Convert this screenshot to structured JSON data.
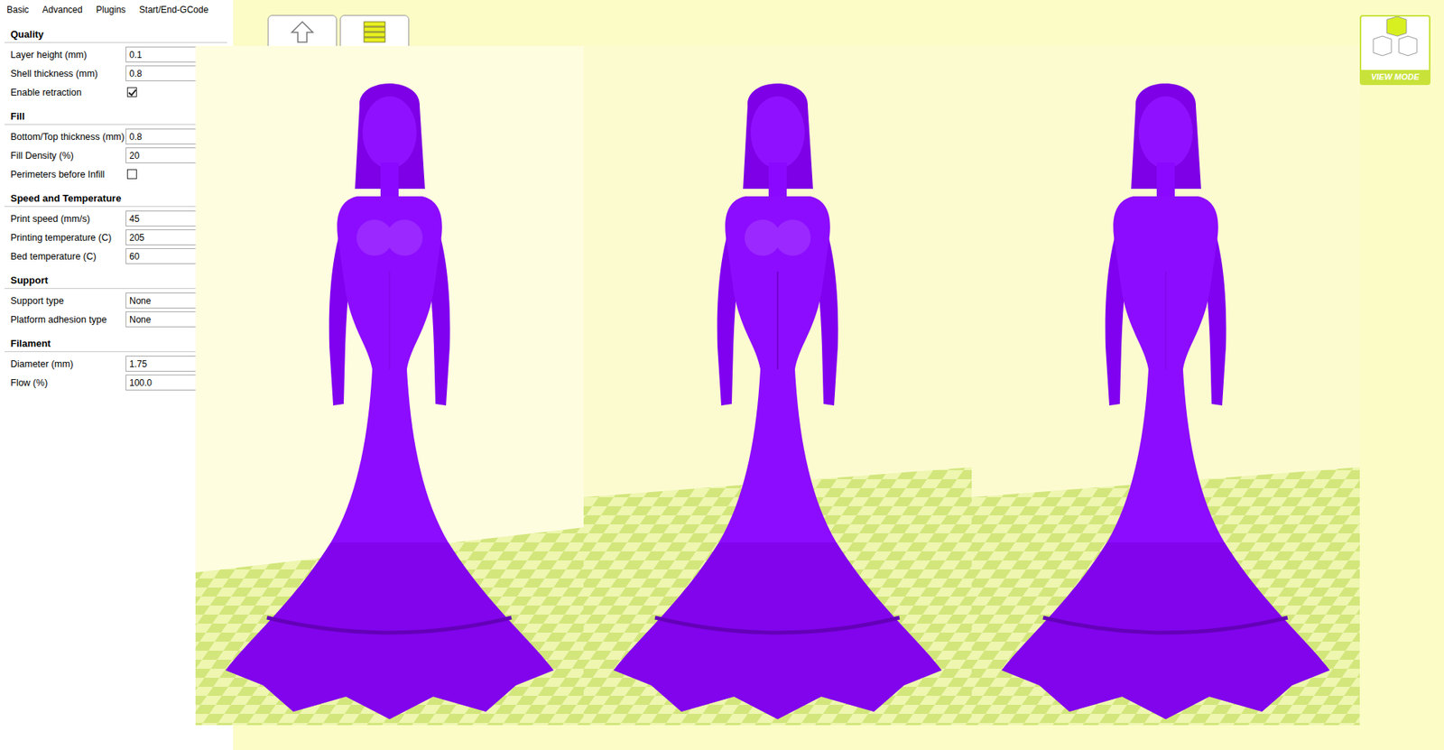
{
  "tabs": [
    {
      "label": "Basic",
      "selected": true
    },
    {
      "label": "Advanced",
      "selected": false
    },
    {
      "label": "Plugins",
      "selected": false
    },
    {
      "label": "Start/End-GCode",
      "selected": false
    }
  ],
  "sections": [
    {
      "title": "Quality",
      "rows": [
        {
          "label": "Layer height (mm)",
          "kind": "field",
          "value": "0.1"
        },
        {
          "label": "Shell thickness (mm)",
          "kind": "field",
          "value": "0.8"
        },
        {
          "label": "Enable retraction",
          "kind": "checkbox",
          "checked": true
        }
      ]
    },
    {
      "title": "Fill",
      "rows": [
        {
          "label": "Bottom/Top thickness (mm)",
          "kind": "field",
          "value": "0.8"
        },
        {
          "label": "Fill Density (%)",
          "kind": "field",
          "value": "20"
        },
        {
          "label": "Perimeters before Infill",
          "kind": "checkbox",
          "checked": false
        }
      ]
    },
    {
      "title": "Speed and Temperature",
      "rows": [
        {
          "label": "Print speed (mm/s)",
          "kind": "field",
          "value": "45"
        },
        {
          "label": "Printing temperature (C)",
          "kind": "field",
          "value": "205"
        },
        {
          "label": "Bed temperature (C)",
          "kind": "field",
          "value": "60"
        }
      ]
    },
    {
      "title": "Support",
      "rows": [
        {
          "label": "Support type",
          "kind": "field",
          "value": "None"
        },
        {
          "label": "Platform adhesion type",
          "kind": "field",
          "value": "None"
        }
      ]
    },
    {
      "title": "Filament",
      "rows": [
        {
          "label": "Diameter (mm)",
          "kind": "field",
          "value": "1.75"
        },
        {
          "label": "Flow (%)",
          "kind": "field",
          "value": "100.0"
        }
      ]
    }
  ],
  "view_mode": {
    "label": "VIEW MODE"
  }
}
